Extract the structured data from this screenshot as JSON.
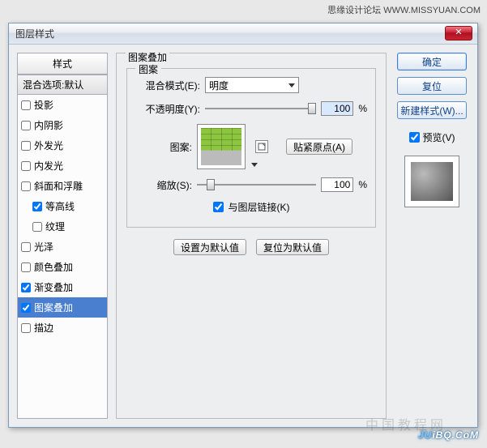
{
  "topAttribution": "思缘设计论坛  WWW.MISSYUAN.COM",
  "dialog": {
    "title": "图层样式"
  },
  "stylesPanel": {
    "header": "样式",
    "blendHeader": "混合选项:默认",
    "items": [
      {
        "label": "投影",
        "checked": false,
        "indent": false
      },
      {
        "label": "内阴影",
        "checked": false,
        "indent": false
      },
      {
        "label": "外发光",
        "checked": false,
        "indent": false
      },
      {
        "label": "内发光",
        "checked": false,
        "indent": false
      },
      {
        "label": "斜面和浮雕",
        "checked": false,
        "indent": false
      },
      {
        "label": "等高线",
        "checked": true,
        "indent": true
      },
      {
        "label": "纹理",
        "checked": false,
        "indent": true
      },
      {
        "label": "光泽",
        "checked": false,
        "indent": false
      },
      {
        "label": "颜色叠加",
        "checked": false,
        "indent": false
      },
      {
        "label": "渐变叠加",
        "checked": true,
        "indent": false
      },
      {
        "label": "图案叠加",
        "checked": true,
        "indent": false,
        "selected": true
      },
      {
        "label": "描边",
        "checked": false,
        "indent": false
      }
    ]
  },
  "main": {
    "sectionTitle": "图案叠加",
    "fieldsetLegend": "图案",
    "blendModeLabel": "混合模式(E):",
    "blendModeValue": "明度",
    "opacityLabel": "不透明度(Y):",
    "opacityValue": "100",
    "opacityUnit": "%",
    "patternLabel": "图案:",
    "snapButton": "贴紧原点(A)",
    "scaleLabel": "缩放(S):",
    "scaleValue": "100",
    "scaleUnit": "%",
    "linkLabel": "与图层链接(K)",
    "linkChecked": true,
    "setDefault": "设置为默认值",
    "resetDefault": "复位为默认值"
  },
  "right": {
    "ok": "确定",
    "reset": "复位",
    "newStyle": "新建样式(W)...",
    "previewLabel": "预览(V)",
    "previewChecked": true
  },
  "watermarkBack": "中国教程网",
  "watermark1": "JU",
  "watermark2": "iBQ.CoM"
}
